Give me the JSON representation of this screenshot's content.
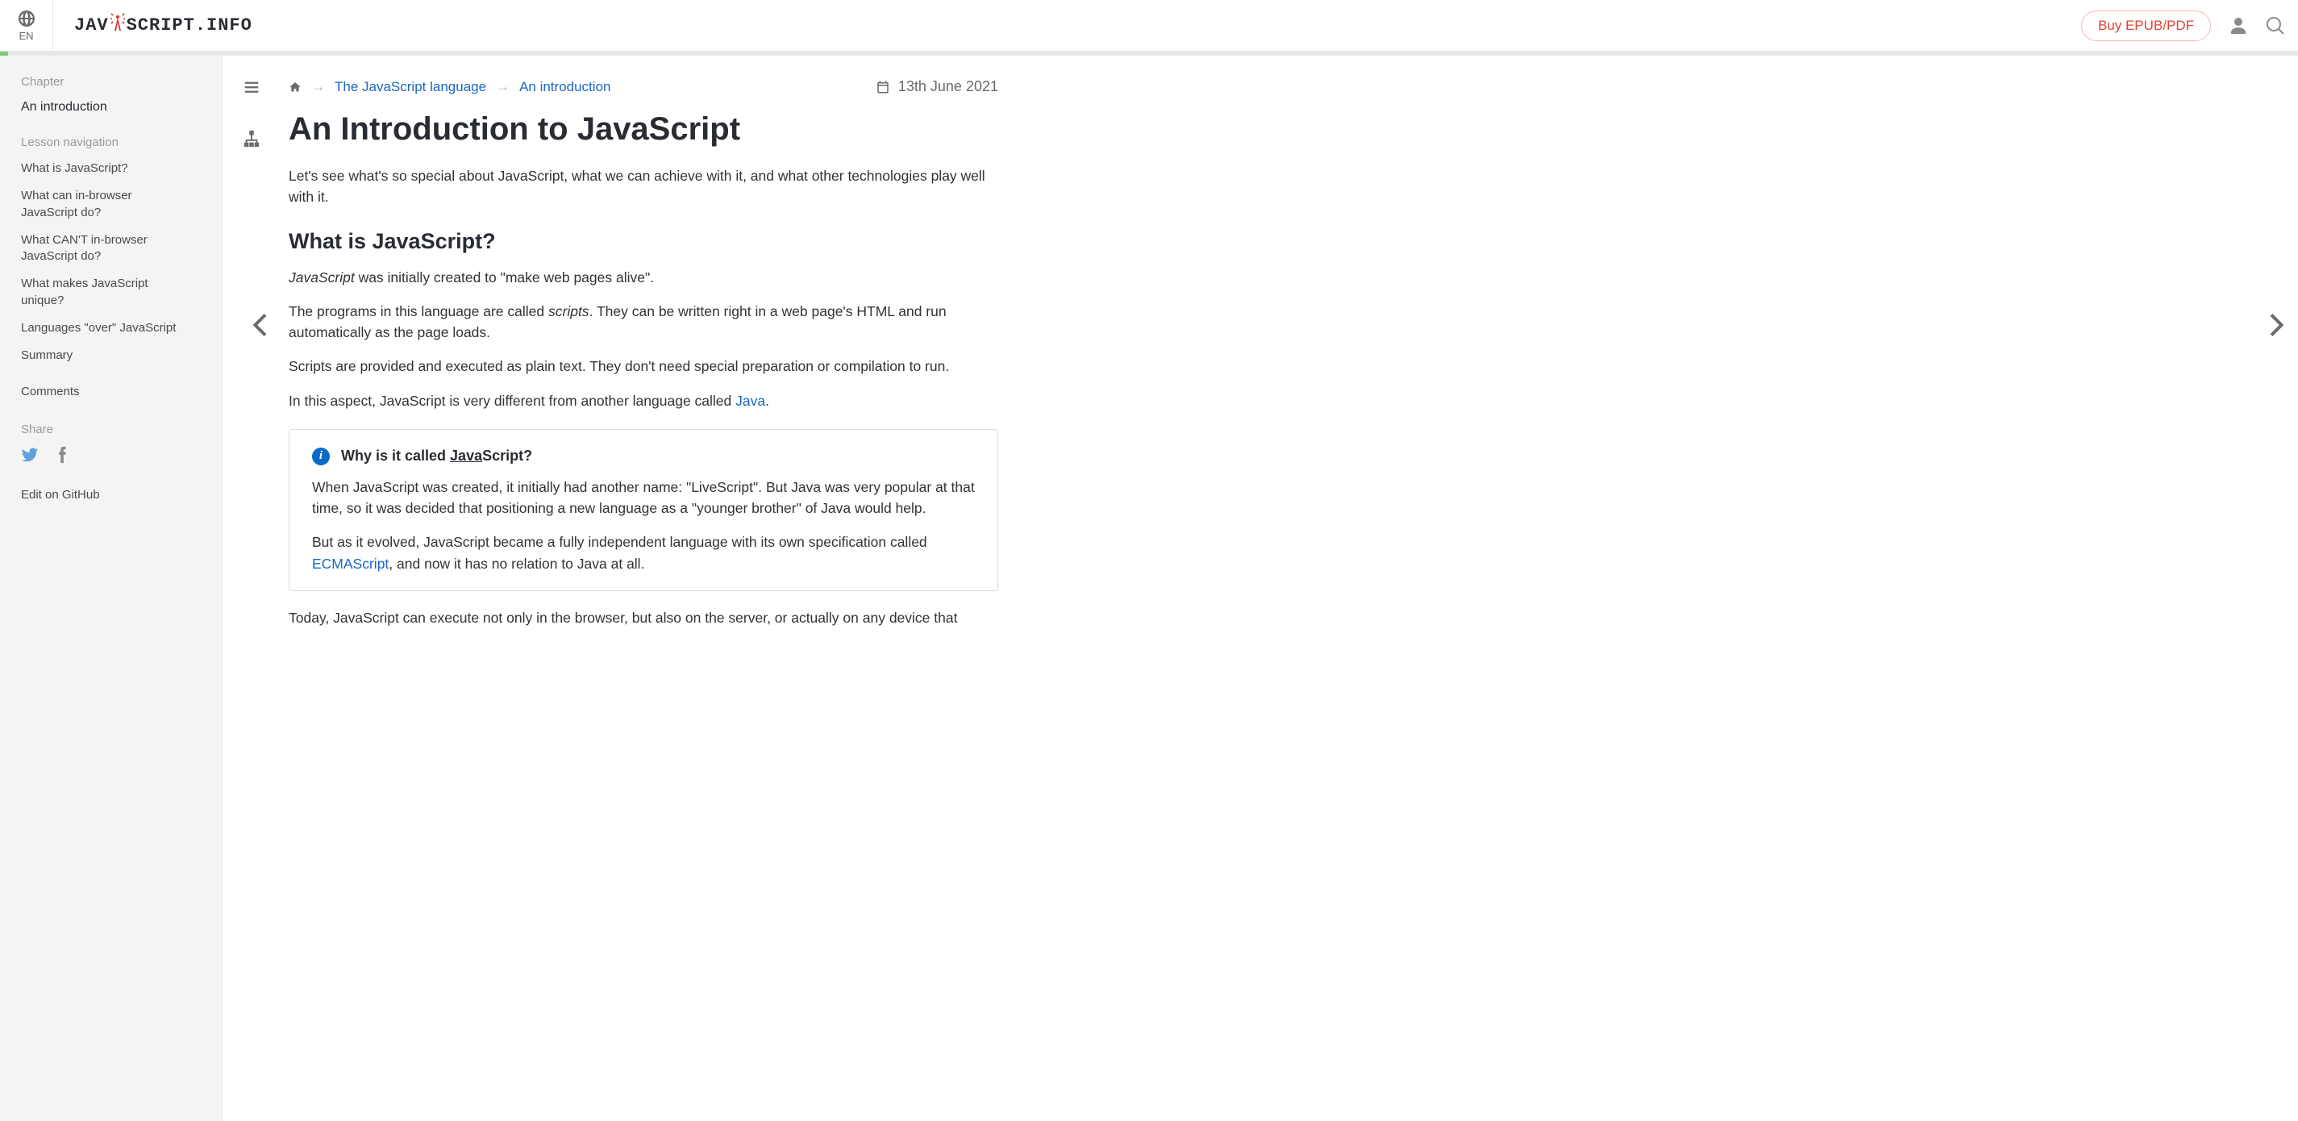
{
  "header": {
    "lang_code": "EN",
    "logo_left": "JAV",
    "logo_right": "SCRIPT.INFO",
    "buy_label": "Buy EPUB/PDF"
  },
  "sidebar": {
    "chapter_label": "Chapter",
    "chapter_link": "An introduction",
    "lesson_nav_label": "Lesson navigation",
    "items": [
      "What is JavaScript?",
      "What can in-browser JavaScript do?",
      "What CAN'T in-browser JavaScript do?",
      "What makes JavaScript unique?",
      "Languages \"over\" JavaScript",
      "Summary"
    ],
    "comments_label": "Comments",
    "share_label": "Share",
    "edit_label": "Edit on GitHub"
  },
  "breadcrumb": {
    "root": "The JavaScript language",
    "current": "An introduction"
  },
  "date": "13th June 2021",
  "article": {
    "title": "An Introduction to JavaScript",
    "intro": "Let's see what's so special about JavaScript, what we can achieve with it, and what other technologies play well with it.",
    "h2_1": "What is JavaScript?",
    "p1_em": "JavaScript",
    "p1_rest": " was initially created to \"make web pages alive\".",
    "p2_a": "The programs in this language are called ",
    "p2_em": "scripts",
    "p2_b": ". They can be written right in a web page's HTML and run automatically as the page loads.",
    "p3": "Scripts are provided and executed as plain text. They don't need special preparation or compilation to run.",
    "p4_a": "In this aspect, JavaScript is very different from another language called ",
    "p4_link": "Java",
    "p4_b": ".",
    "callout": {
      "title_a": "Why is it called ",
      "title_ul": "Java",
      "title_b": "Script?",
      "p1": "When JavaScript was created, it initially had another name: \"LiveScript\". But Java was very popular at that time, so it was decided that positioning a new language as a \"younger brother\" of Java would help.",
      "p2_a": "But as it evolved, JavaScript became a fully independent language with its own specification called ",
      "p2_link": "ECMAScript",
      "p2_b": ", and now it has no relation to Java at all."
    },
    "tail": "Today, JavaScript can execute not only in the browser, but also on the server, or actually on any device that"
  }
}
